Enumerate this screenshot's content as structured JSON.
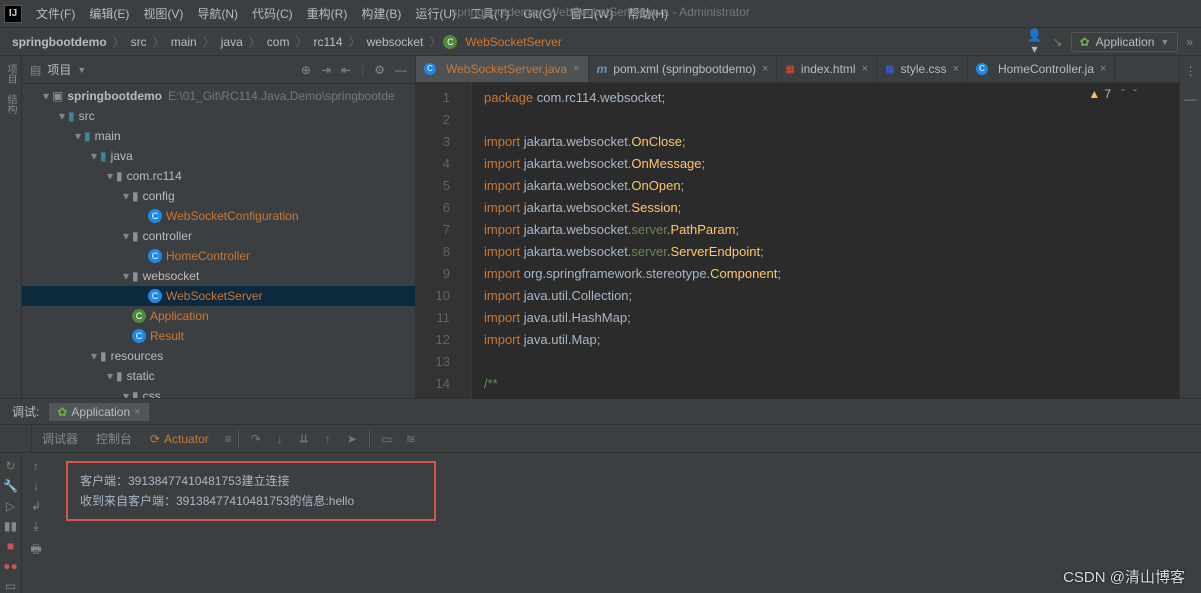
{
  "window_title": "springbootdemo - WebSocketServer.java - Administrator",
  "menu": [
    "文件(F)",
    "编辑(E)",
    "视图(V)",
    "导航(N)",
    "代码(C)",
    "重构(R)",
    "构建(B)",
    "运行(U)",
    "工具(T)",
    "Git(G)",
    "窗口(W)",
    "帮助(H)"
  ],
  "breadcrumbs": [
    "springbootdemo",
    "src",
    "main",
    "java",
    "com",
    "rc114",
    "websocket"
  ],
  "breadcrumb_active": "WebSocketServer",
  "run_config": "Application",
  "project_panel": {
    "title": "项目",
    "root": "springbootdemo",
    "root_path": "E:\\01_Git\\RC114.Java.Demo\\springbootde",
    "nodes": [
      {
        "depth": 1,
        "label": "src",
        "kind": "folder-src",
        "arrow": "▾"
      },
      {
        "depth": 2,
        "label": "main",
        "kind": "folder-src",
        "arrow": "▾"
      },
      {
        "depth": 3,
        "label": "java",
        "kind": "folder-src",
        "arrow": "▾"
      },
      {
        "depth": 4,
        "label": "com.rc114",
        "kind": "folder",
        "arrow": "▾"
      },
      {
        "depth": 5,
        "label": "config",
        "kind": "folder",
        "arrow": "▾"
      },
      {
        "depth": 6,
        "label": "WebSocketConfiguration",
        "kind": "class-link",
        "arrow": ""
      },
      {
        "depth": 5,
        "label": "controller",
        "kind": "folder",
        "arrow": "▾"
      },
      {
        "depth": 6,
        "label": "HomeController",
        "kind": "class-link",
        "arrow": ""
      },
      {
        "depth": 5,
        "label": "websocket",
        "kind": "folder",
        "arrow": "▾"
      },
      {
        "depth": 6,
        "label": "WebSocketServer",
        "kind": "class-link",
        "arrow": "",
        "selected": true
      },
      {
        "depth": 5,
        "label": "Application",
        "kind": "class-run-link",
        "arrow": ""
      },
      {
        "depth": 5,
        "label": "Result",
        "kind": "class-link",
        "arrow": ""
      },
      {
        "depth": 3,
        "label": "resources",
        "kind": "folder-res",
        "arrow": "▾"
      },
      {
        "depth": 4,
        "label": "static",
        "kind": "folder",
        "arrow": "▾"
      },
      {
        "depth": 5,
        "label": "css",
        "kind": "folder",
        "arrow": "▾"
      }
    ]
  },
  "tabs": [
    {
      "label": "WebSocketServer.java",
      "icon": "class",
      "active": true,
      "color": "#cc7832"
    },
    {
      "label": "pom.xml (springbootdemo)",
      "icon": "maven",
      "active": false,
      "color": "#6897bb"
    },
    {
      "label": "index.html",
      "icon": "html",
      "active": false,
      "color": "#bbb"
    },
    {
      "label": "style.css",
      "icon": "css",
      "active": false,
      "color": "#bbb"
    },
    {
      "label": "HomeController.ja",
      "icon": "class",
      "active": false,
      "color": "#bbb"
    }
  ],
  "code_lines": [
    {
      "n": 1,
      "html": "<span class='kw'>package</span> <span class='pkg'>com.rc114.websocket;</span>"
    },
    {
      "n": 2,
      "html": ""
    },
    {
      "n": 3,
      "html": "<span class='kw'>import</span> <span class='pkg'>jakarta.websocket.</span><span class='cls-y'>OnClose</span><span class='pkg'>;</span>"
    },
    {
      "n": 4,
      "html": "<span class='kw'>import</span> <span class='pkg'>jakarta.websocket.</span><span class='cls-y'>OnMessage</span><span class='pkg'>;</span>"
    },
    {
      "n": 5,
      "html": "<span class='kw'>import</span> <span class='pkg'>jakarta.websocket.</span><span class='cls-y'>OnOpen</span><span class='pkg'>;</span>"
    },
    {
      "n": 6,
      "html": "<span class='kw'>import</span> <span class='pkg'>jakarta.websocket.</span><span class='cls-y'>Session</span><span class='pkg'>;</span>"
    },
    {
      "n": 7,
      "html": "<span class='kw'>import</span> <span class='pkg'>jakarta.websocket.</span><span class='cls-g'>server</span><span class='pkg'>.</span><span class='cls-y'>PathParam</span><span class='pkg'>;</span>"
    },
    {
      "n": 8,
      "html": "<span class='kw'>import</span> <span class='pkg'>jakarta.websocket.</span><span class='cls-g'>server</span><span class='pkg'>.</span><span class='cls-y'>ServerEndpoint</span><span class='pkg'>;</span>"
    },
    {
      "n": 9,
      "html": "<span class='kw'>import</span> <span class='pkg'>org.springframework.stereotype.</span><span class='cls-y'>Component</span><span class='pkg'>;</span>"
    },
    {
      "n": 10,
      "html": "<span class='kw'>import</span> <span class='pkg'>java.util.Collection;</span>"
    },
    {
      "n": 11,
      "html": "<span class='kw'>import</span> <span class='pkg'>java.util.HashMap;</span>"
    },
    {
      "n": 12,
      "html": "<span class='kw'>import</span> <span class='pkg'>java.util.Map;</span>"
    },
    {
      "n": 13,
      "html": ""
    },
    {
      "n": 14,
      "html": "<span style='color:#629755'>/**</span>"
    }
  ],
  "warnings": "7",
  "debug": {
    "panel_label": "调试:",
    "tab": "Application",
    "sub_tabs": [
      "调试器",
      "控制台"
    ],
    "actuator": "Actuator"
  },
  "console": [
    "客户端：39138477410481753建立连接",
    "收到来自客户端：39138477410481753的信息:hello"
  ],
  "watermark": "CSDN @清山博客"
}
